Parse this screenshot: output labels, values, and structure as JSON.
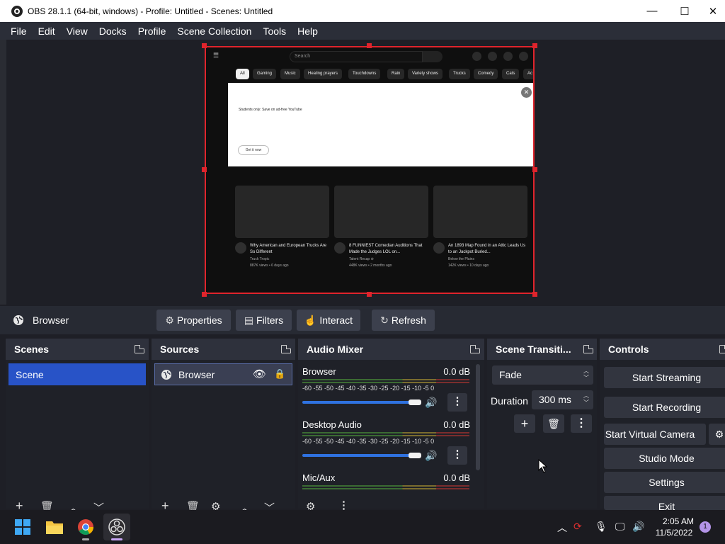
{
  "window": {
    "title": "OBS 28.1.1 (64-bit, windows) - Profile: Untitled - Scenes: Untitled",
    "minimize": "—",
    "maximize": "☐",
    "close": "✕"
  },
  "menu": [
    "File",
    "Edit",
    "View",
    "Docks",
    "Profile",
    "Scene Collection",
    "Tools",
    "Help"
  ],
  "preview": {
    "search_placeholder": "Search",
    "chips": [
      "All",
      "Gaming",
      "Music",
      "Healing prayers",
      "Touchdowns",
      "Rain",
      "Variety shows",
      "Trucks",
      "Comedy",
      "Cats",
      "Ac"
    ],
    "banner_text": "Students only: Save on ad-free YouTube",
    "banner_button": "Get it now",
    "banner_close": "✕",
    "videos": [
      {
        "title": "Why American and European Trucks Are So Different",
        "channel": "Truck Tropic",
        "meta": "887K views • 6 days ago"
      },
      {
        "title": "8 FUNNIEST Comedian Auditions That Made the Judges LOL on...",
        "channel": "Talent Recap ⊘",
        "meta": "448K views • 2 months ago"
      },
      {
        "title": "An 1893 Map Found in an Attic Leads Us to an Jackpot Buried...",
        "channel": "Below the Plains",
        "meta": "142K views • 10 days ago"
      }
    ]
  },
  "context": {
    "source": "Browser",
    "buttons": [
      "Properties",
      "Filters",
      "Interact",
      "Refresh"
    ]
  },
  "scenes": {
    "title": "Scenes",
    "items": [
      "Scene"
    ]
  },
  "sources": {
    "title": "Sources",
    "items": [
      "Browser"
    ]
  },
  "mixer": {
    "title": "Audio Mixer",
    "ticks": "-60 -55 -50 -45 -40 -35 -30 -25 -20 -15 -10  -5   0",
    "channels": [
      {
        "name": "Browser",
        "db": "0.0 dB"
      },
      {
        "name": "Desktop Audio",
        "db": "0.0 dB"
      },
      {
        "name": "Mic/Aux",
        "db": "0.0 dB"
      }
    ]
  },
  "transitions": {
    "title": "Scene Transiti...",
    "selected": "Fade",
    "duration_label": "Duration",
    "duration_value": "300 ms"
  },
  "controls": {
    "title": "Controls",
    "buttons": [
      "Start Streaming",
      "Start Recording",
      "Start Virtual Camera",
      "Studio Mode",
      "Settings",
      "Exit"
    ]
  },
  "taskbar": {
    "time": "2:05 AM",
    "date": "11/5/2022",
    "notifications": "1"
  },
  "colors": {
    "accent_red": "#e0242c",
    "selection_blue": "#2853c7",
    "slider_blue": "#2f72e0"
  }
}
